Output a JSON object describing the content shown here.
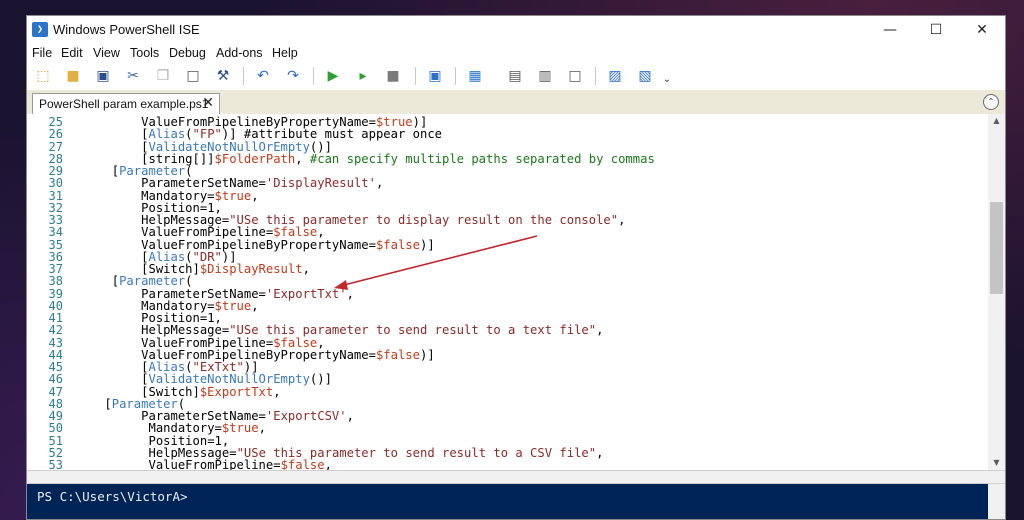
{
  "window": {
    "title": "Windows PowerShell ISE",
    "app_icon_glyph": "❯",
    "minimize_glyph": "—",
    "maximize_glyph": "☐",
    "close_glyph": "✕"
  },
  "menu": [
    "File",
    "Edit",
    "View",
    "Tools",
    "Debug",
    "Add-ons",
    "Help"
  ],
  "toolbar": {
    "buttons": [
      {
        "name": "new-icon",
        "glyph": "⬚",
        "color": "#d8a020"
      },
      {
        "name": "open-icon",
        "glyph": "■",
        "color": "#e0b040"
      },
      {
        "name": "save-icon",
        "glyph": "▣",
        "color": "#2a4e8e"
      },
      {
        "name": "cut-icon",
        "glyph": "✂",
        "color": "#3a66a8"
      },
      {
        "name": "copy-icon",
        "glyph": "❐",
        "color": "#b0b0b0"
      },
      {
        "name": "paste-icon",
        "glyph": "□",
        "color": "#555555"
      },
      {
        "name": "clear-console-icon",
        "glyph": "⚒",
        "color": "#2a4e8e"
      },
      {
        "name": "undo-icon",
        "glyph": "↶",
        "color": "#2a6ec8"
      },
      {
        "name": "redo-icon",
        "glyph": "↷",
        "color": "#2a6ec8"
      },
      {
        "name": "run-script-icon",
        "glyph": "▶",
        "color": "#2fa02f"
      },
      {
        "name": "run-selection-icon",
        "glyph": "▸",
        "color": "#2fa02f"
      },
      {
        "name": "stop-icon",
        "glyph": "■",
        "color": "#7a7a7a"
      },
      {
        "name": "remote-powershell-icon",
        "glyph": "▣",
        "color": "#2a6ec8"
      },
      {
        "name": "powershell-console-icon",
        "glyph": "▦",
        "color": "#2b74c7"
      },
      {
        "name": "show-script-top-icon",
        "glyph": "▤",
        "color": "#555555"
      },
      {
        "name": "show-script-right-icon",
        "glyph": "▥",
        "color": "#555555"
      },
      {
        "name": "show-script-max-icon",
        "glyph": "□",
        "color": "#555555"
      },
      {
        "name": "show-commands-icon",
        "glyph": "▨",
        "color": "#2a6ec8"
      },
      {
        "name": "show-addon-icon",
        "glyph": "▧",
        "color": "#2a6ec8"
      },
      {
        "name": "toolbar-overflow-icon",
        "glyph": "⌄",
        "color": "#333333"
      }
    ]
  },
  "tabs": {
    "active_label": "PowerShell param example.ps1",
    "close_glyph": "✕",
    "collapse_glyph": "⌃"
  },
  "editor": {
    "lines": [
      {
        "n": "25",
        "indent": 9,
        "tokens": [
          {
            "t": "ValueFromPipelineByPropertyName=",
            "c": "plain"
          },
          {
            "t": "$true",
            "c": "var"
          },
          {
            "t": ")]",
            "c": "plain"
          }
        ]
      },
      {
        "n": "26",
        "indent": 9,
        "tokens": [
          {
            "t": "[",
            "c": "plain"
          },
          {
            "t": "Alias",
            "c": "attr"
          },
          {
            "t": "(",
            "c": "plain"
          },
          {
            "t": "\"FP\"",
            "c": "str"
          },
          {
            "t": ")] ",
            "c": "plain"
          },
          {
            "t": "#attribute must appear once",
            "c": "plain"
          }
        ]
      },
      {
        "n": "27",
        "indent": 9,
        "tokens": [
          {
            "t": "[",
            "c": "plain"
          },
          {
            "t": "ValidateNotNullOrEmpty",
            "c": "attr"
          },
          {
            "t": "()]",
            "c": "plain"
          }
        ]
      },
      {
        "n": "28",
        "indent": 9,
        "tokens": [
          {
            "t": "[string[]]",
            "c": "plain"
          },
          {
            "t": "$FolderPath",
            "c": "var"
          },
          {
            "t": ", ",
            "c": "plain"
          },
          {
            "t": "#can specify multiple paths separated by commas",
            "c": "com"
          }
        ]
      },
      {
        "n": "29",
        "indent": 5,
        "tokens": [
          {
            "t": "[",
            "c": "plain"
          },
          {
            "t": "Parameter",
            "c": "attr"
          },
          {
            "t": "(",
            "c": "plain"
          }
        ]
      },
      {
        "n": "30",
        "indent": 9,
        "tokens": [
          {
            "t": "ParameterSetName=",
            "c": "plain"
          },
          {
            "t": "'DisplayResult'",
            "c": "str"
          },
          {
            "t": ",",
            "c": "plain"
          }
        ]
      },
      {
        "n": "31",
        "indent": 9,
        "tokens": [
          {
            "t": "Mandatory=",
            "c": "plain"
          },
          {
            "t": "$true",
            "c": "var"
          },
          {
            "t": ",",
            "c": "plain"
          }
        ]
      },
      {
        "n": "32",
        "indent": 9,
        "tokens": [
          {
            "t": "Position=",
            "c": "plain"
          },
          {
            "t": "1",
            "c": "plain"
          },
          {
            "t": ",",
            "c": "plain"
          }
        ]
      },
      {
        "n": "33",
        "indent": 9,
        "tokens": [
          {
            "t": "HelpMessage=",
            "c": "plain"
          },
          {
            "t": "\"USe this parameter to display result on the console\"",
            "c": "str"
          },
          {
            "t": ",",
            "c": "plain"
          }
        ]
      },
      {
        "n": "34",
        "indent": 9,
        "tokens": [
          {
            "t": "ValueFromPipeline=",
            "c": "plain"
          },
          {
            "t": "$false",
            "c": "var"
          },
          {
            "t": ",",
            "c": "plain"
          }
        ]
      },
      {
        "n": "35",
        "indent": 9,
        "tokens": [
          {
            "t": "ValueFromPipelineByPropertyName=",
            "c": "plain"
          },
          {
            "t": "$false",
            "c": "var"
          },
          {
            "t": ")]",
            "c": "plain"
          }
        ]
      },
      {
        "n": "36",
        "indent": 9,
        "tokens": [
          {
            "t": "[",
            "c": "plain"
          },
          {
            "t": "Alias",
            "c": "attr"
          },
          {
            "t": "(",
            "c": "plain"
          },
          {
            "t": "\"DR\"",
            "c": "str"
          },
          {
            "t": ")]",
            "c": "plain"
          }
        ]
      },
      {
        "n": "37",
        "indent": 9,
        "tokens": [
          {
            "t": "[Switch]",
            "c": "plain"
          },
          {
            "t": "$DisplayResult",
            "c": "var"
          },
          {
            "t": ",",
            "c": "plain"
          }
        ]
      },
      {
        "n": "38",
        "indent": 5,
        "tokens": [
          {
            "t": "[",
            "c": "plain"
          },
          {
            "t": "Parameter",
            "c": "attr"
          },
          {
            "t": "(",
            "c": "plain"
          }
        ]
      },
      {
        "n": "39",
        "indent": 9,
        "tokens": [
          {
            "t": "ParameterSetName=",
            "c": "plain"
          },
          {
            "t": "'ExportTxt'",
            "c": "str"
          },
          {
            "t": ",",
            "c": "plain"
          }
        ]
      },
      {
        "n": "40",
        "indent": 9,
        "tokens": [
          {
            "t": "Mandatory=",
            "c": "plain"
          },
          {
            "t": "$true",
            "c": "var"
          },
          {
            "t": ",",
            "c": "plain"
          }
        ]
      },
      {
        "n": "41",
        "indent": 9,
        "tokens": [
          {
            "t": "Position=",
            "c": "plain"
          },
          {
            "t": "1",
            "c": "plain"
          },
          {
            "t": ",",
            "c": "plain"
          }
        ]
      },
      {
        "n": "42",
        "indent": 9,
        "tokens": [
          {
            "t": "HelpMessage=",
            "c": "plain"
          },
          {
            "t": "\"USe this parameter to send result to a text file\"",
            "c": "str"
          },
          {
            "t": ",",
            "c": "plain"
          }
        ]
      },
      {
        "n": "43",
        "indent": 9,
        "tokens": [
          {
            "t": "ValueFromPipeline=",
            "c": "plain"
          },
          {
            "t": "$false",
            "c": "var"
          },
          {
            "t": ",",
            "c": "plain"
          }
        ]
      },
      {
        "n": "44",
        "indent": 9,
        "tokens": [
          {
            "t": "ValueFromPipelineByPropertyName=",
            "c": "plain"
          },
          {
            "t": "$false",
            "c": "var"
          },
          {
            "t": ")]",
            "c": "plain"
          }
        ]
      },
      {
        "n": "45",
        "indent": 9,
        "tokens": [
          {
            "t": "[",
            "c": "plain"
          },
          {
            "t": "Alias",
            "c": "attr"
          },
          {
            "t": "(",
            "c": "plain"
          },
          {
            "t": "\"ExTxt\"",
            "c": "str"
          },
          {
            "t": ")]",
            "c": "plain"
          }
        ]
      },
      {
        "n": "46",
        "indent": 9,
        "tokens": [
          {
            "t": "[",
            "c": "plain"
          },
          {
            "t": "ValidateNotNullOrEmpty",
            "c": "attr"
          },
          {
            "t": "()]",
            "c": "plain"
          }
        ]
      },
      {
        "n": "47",
        "indent": 9,
        "tokens": [
          {
            "t": "[Switch]",
            "c": "plain"
          },
          {
            "t": "$ExportTxt",
            "c": "var"
          },
          {
            "t": ",",
            "c": "plain"
          }
        ]
      },
      {
        "n": "48",
        "indent": 4,
        "tokens": [
          {
            "t": "[",
            "c": "plain"
          },
          {
            "t": "Parameter",
            "c": "attr"
          },
          {
            "t": "(",
            "c": "plain"
          }
        ]
      },
      {
        "n": "49",
        "indent": 9,
        "tokens": [
          {
            "t": "ParameterSetName=",
            "c": "plain"
          },
          {
            "t": "'ExportCSV'",
            "c": "str"
          },
          {
            "t": ",",
            "c": "plain"
          }
        ]
      },
      {
        "n": "50",
        "indent": 10,
        "tokens": [
          {
            "t": "Mandatory=",
            "c": "plain"
          },
          {
            "t": "$true",
            "c": "var"
          },
          {
            "t": ",",
            "c": "plain"
          }
        ]
      },
      {
        "n": "51",
        "indent": 10,
        "tokens": [
          {
            "t": "Position=",
            "c": "plain"
          },
          {
            "t": "1",
            "c": "plain"
          },
          {
            "t": ",",
            "c": "plain"
          }
        ]
      },
      {
        "n": "52",
        "indent": 10,
        "tokens": [
          {
            "t": "HelpMessage=",
            "c": "plain"
          },
          {
            "t": "\"USe this parameter to send result to a CSV file\"",
            "c": "str"
          },
          {
            "t": ",",
            "c": "plain"
          }
        ]
      },
      {
        "n": "53",
        "indent": 10,
        "tokens": [
          {
            "t": "ValueFromPipeline=",
            "c": "plain"
          },
          {
            "t": "$false",
            "c": "var"
          },
          {
            "t": ",",
            "c": "plain"
          }
        ]
      }
    ],
    "scroll_up_glyph": "▲",
    "scroll_down_glyph": "▼"
  },
  "console": {
    "prompt": "PS C:\\Users\\VictorA>"
  },
  "colors": {
    "annotation_arrow": "#c0282e",
    "console_bg": "#012456"
  }
}
